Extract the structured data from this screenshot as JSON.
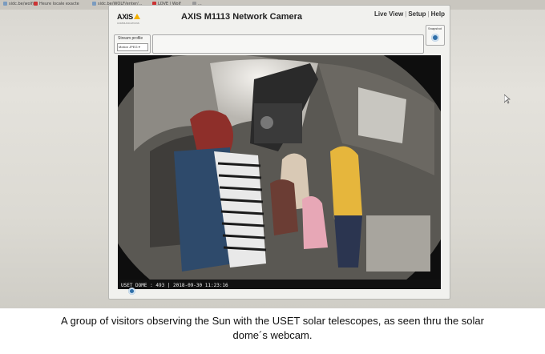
{
  "browser": {
    "tabs": [
      {
        "label": "sidc.be/wolf/"
      },
      {
        "label": "Heure locale exacte"
      },
      {
        "label": "sidc.be/WOLF/enter/..."
      },
      {
        "label": "LOVE | Wolf"
      },
      {
        "label": "..."
      }
    ]
  },
  "camera_page": {
    "logo_text": "AXIS",
    "logo_sub": "COMMUNICATIONS",
    "title": "AXIS M1113 Network Camera",
    "nav": {
      "live_view": "Live View",
      "setup": "Setup",
      "help": "Help",
      "separator": "|"
    },
    "stream_profile_label": "Stream profile",
    "stream_profile_value": "Motion JPEG",
    "snapshot_label": "Snapshot",
    "video_overlay": "USET DOME : 493 | 2018-09-30 11:23:16"
  },
  "caption": {
    "line1": "A group of visitors observing the Sun with the USET solar telescopes, as seen thru the solar",
    "line2": "dome´s webcam."
  },
  "colors": {
    "logo_accent": "#f3b100",
    "icon_blue": "#2f6fa8"
  }
}
